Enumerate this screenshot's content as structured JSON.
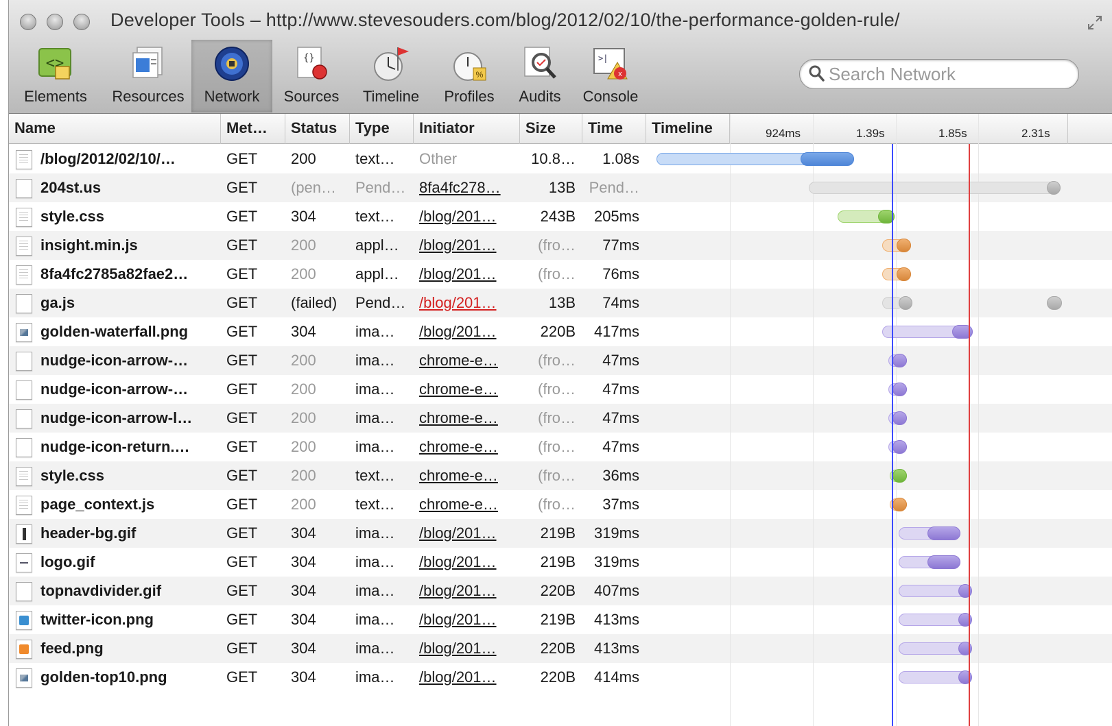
{
  "window": {
    "title": "Developer Tools – http://www.stevesouders.com/blog/2012/02/10/the-performance-golden-rule/"
  },
  "toolbar": {
    "tabs": [
      {
        "label": "Elements",
        "icon": "elements-icon"
      },
      {
        "label": "Resources",
        "icon": "resources-icon"
      },
      {
        "label": "Network",
        "icon": "network-icon",
        "selected": true
      },
      {
        "label": "Sources",
        "icon": "sources-icon"
      },
      {
        "label": "Timeline",
        "icon": "timeline-icon"
      },
      {
        "label": "Profiles",
        "icon": "profiles-icon"
      },
      {
        "label": "Audits",
        "icon": "audits-icon"
      },
      {
        "label": "Console",
        "icon": "console-icon"
      }
    ],
    "search_placeholder": "Search Network"
  },
  "grid": {
    "columns": [
      "Name",
      "Met…",
      "Status",
      "Type",
      "Initiator",
      "Size",
      "Time",
      "Timeline"
    ],
    "timeline_ticks": [
      "924ms",
      "1.39s",
      "1.85s",
      "2.31s"
    ],
    "markers": {
      "blue": "#3d4bff",
      "red": "#e04040"
    },
    "rows": [
      {
        "icon": "doc",
        "name": "/blog/2012/02/10/…",
        "method": "GET",
        "status": "200",
        "type": "text…",
        "initiator": "Other",
        "initiator_link": false,
        "size": "10.8…",
        "time": "1.08s",
        "state": "normal",
        "bar": {
          "color": "blue",
          "start": 0.0,
          "split": 0.35,
          "end": 0.48
        }
      },
      {
        "icon": "blank",
        "name": "204st.us",
        "method": "GET",
        "status": "(pen…",
        "type": "Pend…",
        "initiator": "8fa4fc278…",
        "initiator_link": true,
        "size": "13B",
        "time": "Pend…",
        "state": "pending",
        "bar": {
          "color": "gray",
          "start": 0.37,
          "split": 0.95,
          "end": 0.97
        }
      },
      {
        "icon": "doc",
        "name": "style.css",
        "method": "GET",
        "status": "304",
        "type": "text…",
        "initiator": "/blog/201…",
        "initiator_link": true,
        "size": "243B",
        "time": "205ms",
        "state": "normal",
        "bar": {
          "color": "green",
          "start": 0.44,
          "split": 0.54,
          "end": 0.58
        }
      },
      {
        "icon": "doc",
        "name": "insight.min.js",
        "method": "GET",
        "status": "200",
        "type": "appl…",
        "initiator": "/blog/201…",
        "initiator_link": true,
        "size": "(fro…",
        "time": "77ms",
        "state": "cached",
        "bar": {
          "color": "orange",
          "start": 0.55,
          "split": 0.585,
          "end": 0.62
        }
      },
      {
        "icon": "doc",
        "name": "8fa4fc2785a82fae2…",
        "method": "GET",
        "status": "200",
        "type": "appl…",
        "initiator": "/blog/201…",
        "initiator_link": true,
        "size": "(fro…",
        "time": "76ms",
        "state": "cached",
        "bar": {
          "color": "orange",
          "start": 0.55,
          "split": 0.585,
          "end": 0.62
        }
      },
      {
        "icon": "blank",
        "name": "ga.js",
        "method": "GET",
        "status": "(failed)",
        "type": "Pend…",
        "initiator": "/blog/201…",
        "initiator_link": true,
        "size": "13B",
        "time": "74ms",
        "state": "failed",
        "bar": {
          "color": "gray",
          "start": 0.55,
          "split": 0.59,
          "end": 0.6,
          "tail": 0.95
        }
      },
      {
        "icon": "img-pic",
        "name": "golden-waterfall.png",
        "method": "GET",
        "status": "304",
        "type": "ima…",
        "initiator": "/blog/201…",
        "initiator_link": true,
        "size": "220B",
        "time": "417ms",
        "state": "normal",
        "bar": {
          "color": "purple",
          "start": 0.55,
          "split": 0.72,
          "end": 0.77
        }
      },
      {
        "icon": "blank",
        "name": "nudge-icon-arrow-…",
        "method": "GET",
        "status": "200",
        "type": "ima…",
        "initiator": "chrome-e…",
        "initiator_link": true,
        "size": "(fro…",
        "time": "47ms",
        "state": "cached",
        "bar": {
          "color": "purple",
          "start": 0.565,
          "split": 0.575,
          "end": 0.61
        }
      },
      {
        "icon": "blank",
        "name": "nudge-icon-arrow-…",
        "method": "GET",
        "status": "200",
        "type": "ima…",
        "initiator": "chrome-e…",
        "initiator_link": true,
        "size": "(fro…",
        "time": "47ms",
        "state": "cached",
        "bar": {
          "color": "purple",
          "start": 0.565,
          "split": 0.575,
          "end": 0.61
        }
      },
      {
        "icon": "blank",
        "name": "nudge-icon-arrow-l…",
        "method": "GET",
        "status": "200",
        "type": "ima…",
        "initiator": "chrome-e…",
        "initiator_link": true,
        "size": "(fro…",
        "time": "47ms",
        "state": "cached",
        "bar": {
          "color": "purple",
          "start": 0.565,
          "split": 0.575,
          "end": 0.61
        }
      },
      {
        "icon": "blank",
        "name": "nudge-icon-return.…",
        "method": "GET",
        "status": "200",
        "type": "ima…",
        "initiator": "chrome-e…",
        "initiator_link": true,
        "size": "(fro…",
        "time": "47ms",
        "state": "cached",
        "bar": {
          "color": "purple",
          "start": 0.565,
          "split": 0.575,
          "end": 0.61
        }
      },
      {
        "icon": "doc",
        "name": "style.css",
        "method": "GET",
        "status": "200",
        "type": "text…",
        "initiator": "chrome-e…",
        "initiator_link": true,
        "size": "(fro…",
        "time": "36ms",
        "state": "cached",
        "bar": {
          "color": "green",
          "start": 0.568,
          "split": 0.575,
          "end": 0.61
        }
      },
      {
        "icon": "doc",
        "name": "page_context.js",
        "method": "GET",
        "status": "200",
        "type": "text…",
        "initiator": "chrome-e…",
        "initiator_link": true,
        "size": "(fro…",
        "time": "37ms",
        "state": "cached",
        "bar": {
          "color": "orange",
          "start": 0.568,
          "split": 0.575,
          "end": 0.61
        }
      },
      {
        "icon": "img-bar",
        "name": "header-bg.gif",
        "method": "GET",
        "status": "304",
        "type": "ima…",
        "initiator": "/blog/201…",
        "initiator_link": true,
        "size": "219B",
        "time": "319ms",
        "state": "normal",
        "bar": {
          "color": "purple",
          "start": 0.59,
          "split": 0.66,
          "end": 0.74
        }
      },
      {
        "icon": "img-line",
        "name": "logo.gif",
        "method": "GET",
        "status": "304",
        "type": "ima…",
        "initiator": "/blog/201…",
        "initiator_link": true,
        "size": "219B",
        "time": "319ms",
        "state": "normal",
        "bar": {
          "color": "purple",
          "start": 0.59,
          "split": 0.66,
          "end": 0.74
        }
      },
      {
        "icon": "blank",
        "name": "topnavdivider.gif",
        "method": "GET",
        "status": "304",
        "type": "ima…",
        "initiator": "/blog/201…",
        "initiator_link": true,
        "size": "220B",
        "time": "407ms",
        "state": "normal",
        "bar": {
          "color": "purple",
          "start": 0.59,
          "split": 0.735,
          "end": 0.76
        }
      },
      {
        "icon": "img-twitter",
        "name": "twitter-icon.png",
        "method": "GET",
        "status": "304",
        "type": "ima…",
        "initiator": "/blog/201…",
        "initiator_link": true,
        "size": "219B",
        "time": "413ms",
        "state": "normal",
        "bar": {
          "color": "purple",
          "start": 0.59,
          "split": 0.735,
          "end": 0.765
        }
      },
      {
        "icon": "img-feed",
        "name": "feed.png",
        "method": "GET",
        "status": "304",
        "type": "ima…",
        "initiator": "/blog/201…",
        "initiator_link": true,
        "size": "220B",
        "time": "413ms",
        "state": "normal",
        "bar": {
          "color": "purple",
          "start": 0.59,
          "split": 0.735,
          "end": 0.765
        }
      },
      {
        "icon": "img-pic",
        "name": "golden-top10.png",
        "method": "GET",
        "status": "304",
        "type": "ima…",
        "initiator": "/blog/201…",
        "initiator_link": true,
        "size": "220B",
        "time": "414ms",
        "state": "normal",
        "bar": {
          "color": "purple",
          "start": 0.59,
          "split": 0.735,
          "end": 0.765
        }
      }
    ]
  }
}
